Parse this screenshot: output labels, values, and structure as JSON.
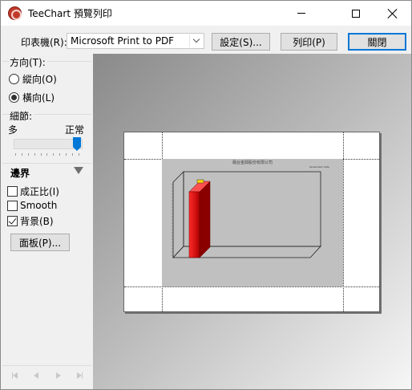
{
  "window": {
    "title": "TeeChart 預覽列印",
    "icon": "teechart-app-icon",
    "controls": [
      "minimize-icon",
      "maximize-icon",
      "close-icon"
    ]
  },
  "toolbar": {
    "printer_label": "印表機(R):",
    "printer_value": "Microsoft Print to PDF",
    "setup_label": "設定(S)...",
    "print_label": "列印(P)",
    "close_label": "關閉"
  },
  "panel": {
    "orientation": {
      "title": "方向(T):",
      "portrait_label": "縱向(O)",
      "landscape_label": "橫向(L)",
      "selected": "landscape"
    },
    "detail": {
      "title": "細節:",
      "min_label": "多",
      "max_label": "正常",
      "level": 1.0
    },
    "margins": {
      "title": "邊界",
      "proportional_label": "成正比(I)",
      "proportional_checked": false,
      "smooth_label": "Smooth",
      "smooth_checked": false,
      "background_label": "背景(B)",
      "background_checked": true
    },
    "panel_button_label": "面板(P)...",
    "nav_icons": [
      "first-page-icon",
      "prev-page-icon",
      "next-page-icon",
      "last-page-icon"
    ]
  },
  "preview": {
    "chart_title": "鳳台金興股份有限公司",
    "legend_text": "Series·Item·data",
    "colors": {
      "bar": "#e00000",
      "bar_dark": "#8a0000",
      "highlight": "#ffd800",
      "chart_bg": "#c0c0c0"
    }
  }
}
